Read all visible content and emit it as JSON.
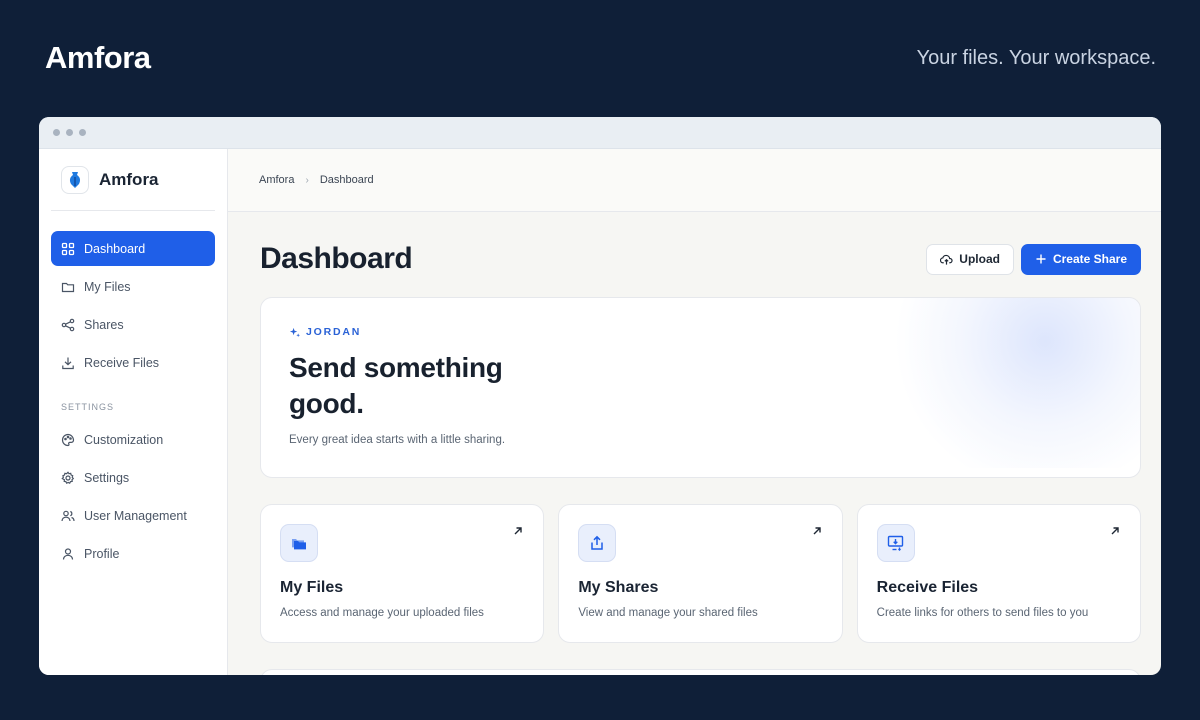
{
  "header": {
    "brand": "Amfora",
    "tagline": "Your files. Your workspace."
  },
  "sidebar": {
    "brand": "Amfora",
    "items": [
      {
        "label": "Dashboard",
        "icon": "grid-icon",
        "active": true
      },
      {
        "label": "My Files",
        "icon": "folder-icon"
      },
      {
        "label": "Shares",
        "icon": "share-icon"
      },
      {
        "label": "Receive Files",
        "icon": "download-icon"
      }
    ],
    "settings_label": "SETTINGS",
    "settings_items": [
      {
        "label": "Customization",
        "icon": "palette-icon"
      },
      {
        "label": "Settings",
        "icon": "gear-icon"
      },
      {
        "label": "User Management",
        "icon": "users-icon"
      },
      {
        "label": "Profile",
        "icon": "user-icon"
      }
    ]
  },
  "breadcrumb": [
    "Amfora",
    "Dashboard"
  ],
  "main": {
    "title": "Dashboard",
    "upload_label": "Upload",
    "create_share_label": "Create Share"
  },
  "hero": {
    "kicker": "JORDAN",
    "title": "Send something good.",
    "subtitle": "Every great idea starts with a little sharing."
  },
  "cards": [
    {
      "title": "My Files",
      "description": "Access and manage your uploaded files",
      "icon": "folders-icon"
    },
    {
      "title": "My Shares",
      "description": "View and manage your shared files",
      "icon": "share-upload-icon"
    },
    {
      "title": "Receive Files",
      "description": "Create links for others to send files to you",
      "icon": "monitor-download-icon"
    }
  ],
  "colors": {
    "background": "#0f1f38",
    "accent": "#1f5fe8",
    "window": "#f6f6f3"
  }
}
